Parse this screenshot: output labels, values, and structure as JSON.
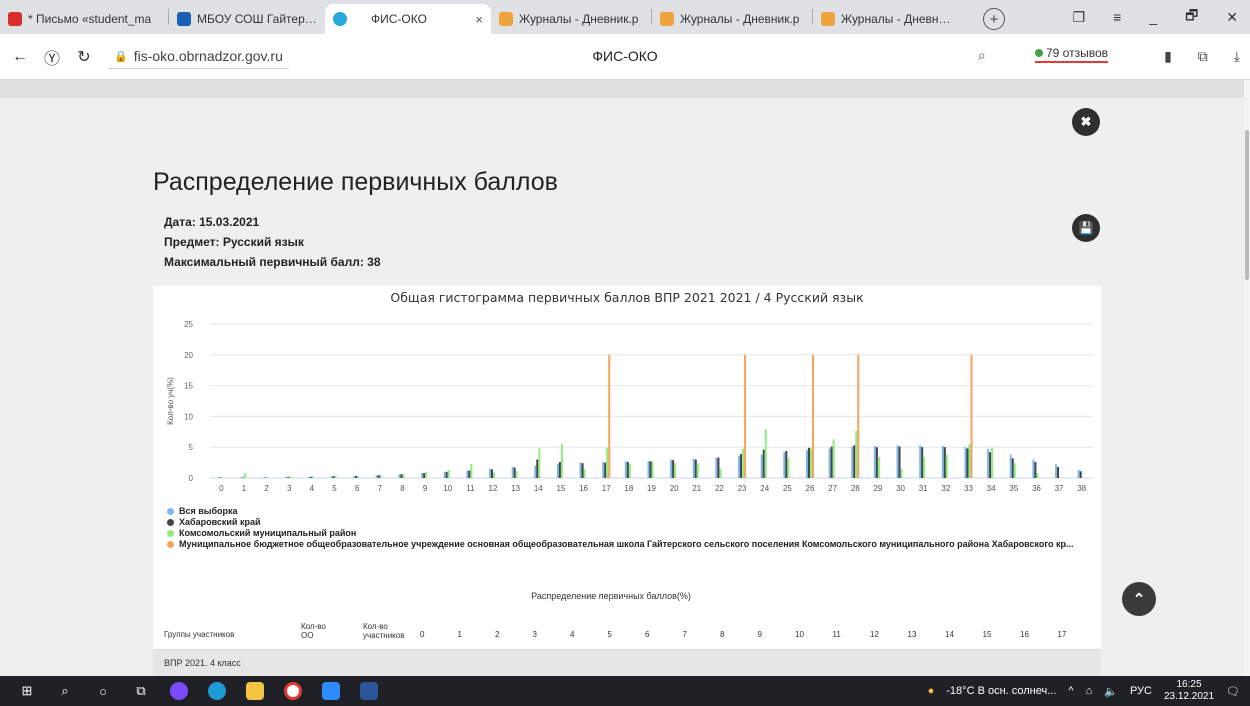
{
  "tabs": [
    {
      "label": "* Письмо «student_ma",
      "color": "#d9302b"
    },
    {
      "label": "МБОУ СОШ Гайтерско",
      "color": "#1a5fb4"
    },
    {
      "label": "ФИС-ОКО",
      "color": "#29a8dc",
      "active": true,
      "close": "×"
    },
    {
      "label": "Журналы - Дневник.р",
      "color": "#f0a23b"
    },
    {
      "label": "Журналы - Дневник.р",
      "color": "#f0a23b"
    },
    {
      "label": "Журналы - Дневник.р",
      "color": "#f0a23b"
    }
  ],
  "browser": {
    "url": "fis-oko.obrnadzor.gov.ru",
    "page_title": "ФИС-ОКО",
    "reviews": "79 отзывов"
  },
  "page": {
    "title": "Распределение первичных баллов",
    "date": "Дата: 15.03.2021",
    "subject": "Предмет: Русский язык",
    "max_score": "Максимальный первичный балл: 38"
  },
  "chart_data": {
    "type": "bar",
    "title": "Общая гистограмма первичных баллов ВПР 2021 2021 / 4 Русский язык",
    "ylabel": "Кол-во уч(%)",
    "xlabel": "",
    "ylim": [
      0,
      25
    ],
    "yticks": [
      0,
      5,
      10,
      15,
      20,
      25
    ],
    "categories": [
      "0",
      "1",
      "2",
      "3",
      "4",
      "5",
      "6",
      "7",
      "8",
      "9",
      "10",
      "11",
      "12",
      "13",
      "14",
      "15",
      "16",
      "17",
      "18",
      "19",
      "20",
      "21",
      "22",
      "23",
      "24",
      "25",
      "26",
      "27",
      "28",
      "29",
      "30",
      "31",
      "32",
      "33",
      "34",
      "35",
      "36",
      "37",
      "38"
    ],
    "series": [
      {
        "name": "Вся выборка",
        "color": "#7cb5ec",
        "values": [
          0.1,
          0.1,
          0.1,
          0.15,
          0.2,
          0.25,
          0.35,
          0.45,
          0.6,
          0.8,
          1.0,
          1.2,
          1.5,
          1.8,
          2.0,
          2.3,
          2.5,
          2.6,
          2.7,
          2.8,
          3.0,
          3.1,
          3.3,
          3.6,
          3.8,
          4.2,
          4.5,
          4.8,
          5.1,
          5.2,
          5.3,
          5.3,
          5.2,
          5.0,
          4.7,
          3.8,
          3.0,
          2.2,
          1.3
        ]
      },
      {
        "name": "Хабаровский край",
        "color": "#434348",
        "values": [
          0.1,
          0.1,
          0.1,
          0.15,
          0.2,
          0.3,
          0.35,
          0.45,
          0.6,
          0.8,
          1.0,
          1.2,
          1.4,
          1.7,
          3.0,
          2.6,
          2.4,
          2.5,
          2.6,
          2.7,
          2.9,
          3.0,
          3.3,
          3.9,
          4.6,
          4.4,
          4.9,
          5.1,
          5.3,
          5.0,
          5.1,
          5.0,
          5.0,
          4.8,
          4.2,
          3.2,
          2.6,
          1.8,
          1.1
        ]
      },
      {
        "name": "Комсомольский муниципальный район",
        "color": "#90ed7d",
        "values": [
          0.0,
          0.8,
          0.0,
          0.3,
          0.3,
          0.4,
          0.3,
          0.5,
          0.7,
          1.0,
          1.3,
          2.3,
          0.9,
          1.1,
          4.8,
          5.5,
          1.4,
          4.9,
          2.3,
          2.7,
          2.4,
          2.4,
          1.5,
          4.8,
          7.9,
          3.3,
          4.8,
          6.3,
          7.7,
          3.4,
          1.5,
          3.4,
          3.8,
          5.5,
          4.9,
          2.4,
          0.8,
          0.0,
          0.0
        ]
      },
      {
        "name": "Муниципальное бюджетное общеобразовательное учреждение основная общеобразовательная школа Гайтерского сельского поселения Комсомольского муниципального района Хабаровского кр...",
        "color": "#f7a35c",
        "values": [
          0,
          0,
          0,
          0,
          0,
          0,
          0,
          0,
          0,
          0,
          0,
          0,
          0,
          0,
          0,
          0,
          0,
          20,
          0,
          0,
          0,
          0,
          0,
          20,
          0,
          0,
          20,
          0,
          20,
          0,
          0,
          0,
          0,
          20,
          0,
          0,
          0,
          0,
          0
        ]
      }
    ]
  },
  "table": {
    "caption": "Распределение первичных баллов(%)",
    "col_groups": "Группы участников",
    "col_oo": [
      "Кол-во",
      "ОО"
    ],
    "col_participants": [
      "Кол-во",
      "участников"
    ],
    "score_cols": [
      "0",
      "1",
      "2",
      "3",
      "4",
      "5",
      "6",
      "7",
      "8",
      "9",
      "10",
      "11",
      "12",
      "13",
      "14",
      "15",
      "16",
      "17"
    ],
    "first_row": "ВПР 2021. 4 класс"
  },
  "taskbar": {
    "weather": "-18°C  В осн. солнеч...",
    "lang": "РУС",
    "time": "16:25",
    "date": "23.12.2021"
  }
}
